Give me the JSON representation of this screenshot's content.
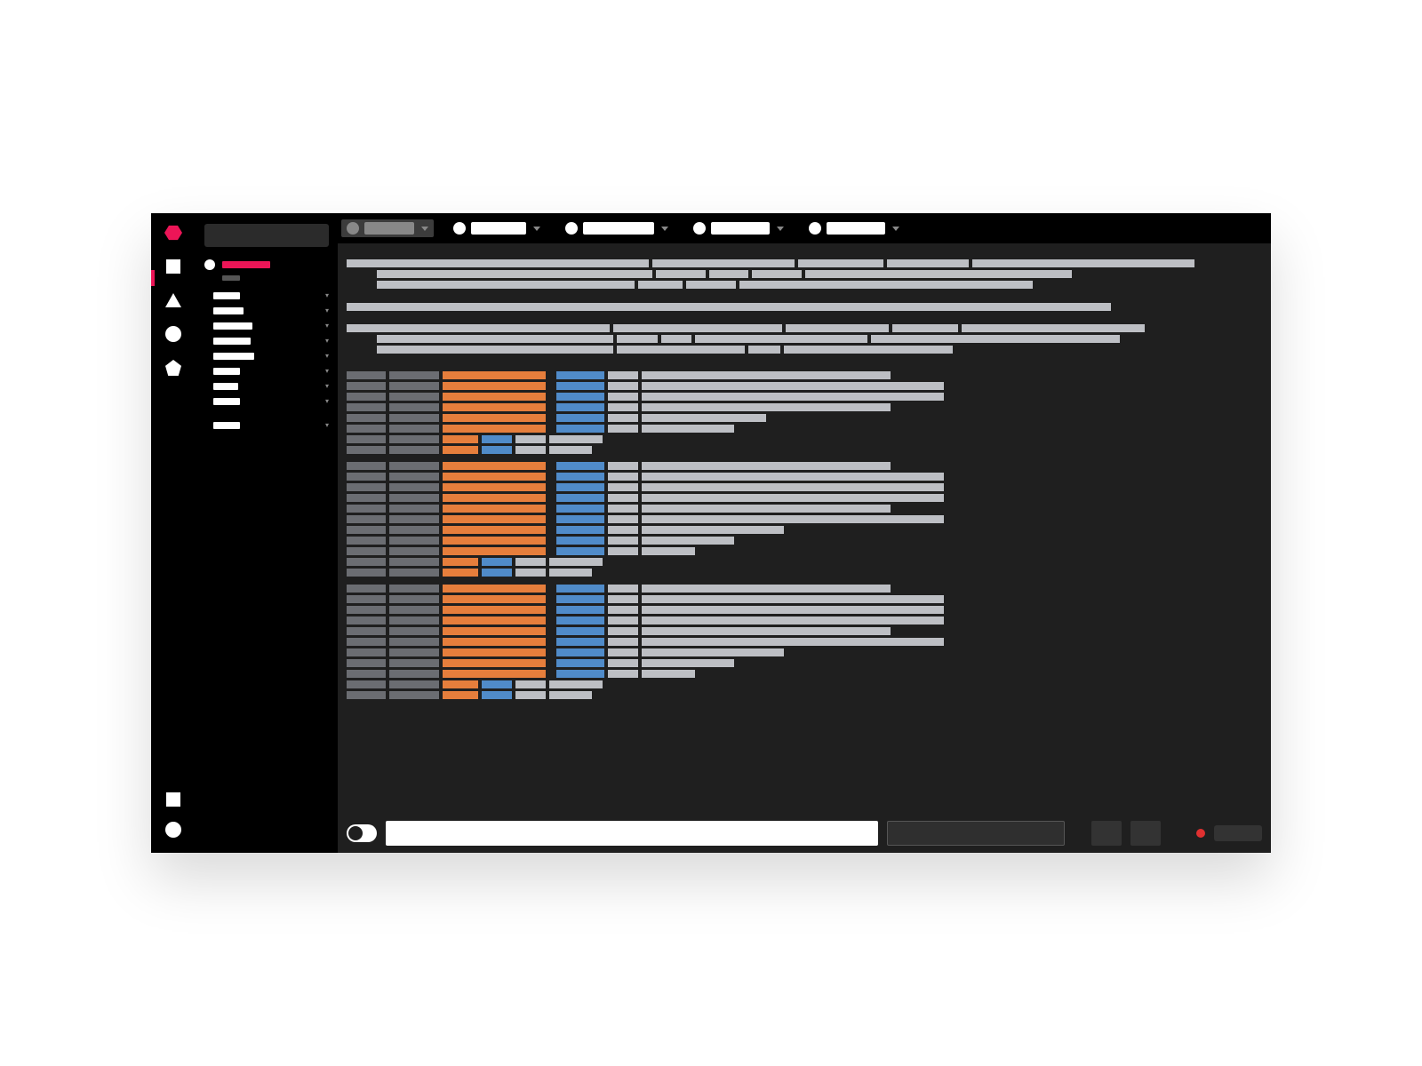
{
  "rail": {
    "icons": [
      "hexagon",
      "square",
      "triangle",
      "circle",
      "pentagon"
    ],
    "bottom_icons": [
      "square",
      "circle"
    ]
  },
  "sidebar": {
    "search_placeholder": "",
    "active_item": "",
    "items": [
      {
        "label": "",
        "expandable": true
      },
      {
        "label": "",
        "expandable": true
      },
      {
        "label": "",
        "expandable": true
      },
      {
        "label": "",
        "expandable": true
      },
      {
        "label": "",
        "expandable": true
      },
      {
        "label": "",
        "expandable": true
      },
      {
        "label": "",
        "expandable": true
      },
      {
        "label": "",
        "expandable": true
      },
      {
        "label": "",
        "expandable": true
      }
    ]
  },
  "toolbar": {
    "tabs": [
      {
        "label": "",
        "active": true,
        "dot": "grey",
        "label_color": "grey"
      },
      {
        "label": "",
        "active": false
      },
      {
        "label": "",
        "active": false
      },
      {
        "label": "",
        "active": false
      },
      {
        "label": "",
        "active": false
      }
    ]
  },
  "colors": {
    "accent": "#ec1557",
    "orange": "#e67e3c",
    "blue": "#508bc9",
    "text": "#bdbfc4",
    "muted": "#6b6d72"
  },
  "bottombar": {
    "toggle_on": false,
    "command_value": "",
    "recording": true
  }
}
